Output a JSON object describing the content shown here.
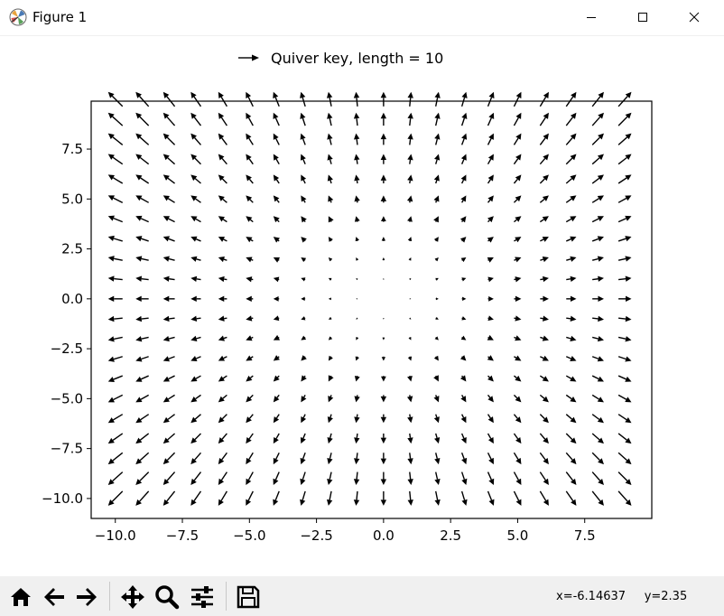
{
  "window": {
    "title": "Figure 1",
    "icon": "matplotlib-icon",
    "controls": [
      "minimize-icon",
      "maximize-icon",
      "close-icon"
    ]
  },
  "chart_data": {
    "type": "quiver",
    "title": "",
    "xlabel": "",
    "ylabel": "",
    "xlim": [
      -10.9,
      10.0
    ],
    "ylim": [
      -11.0,
      9.9
    ],
    "x_start": -10.0,
    "y_start": -10.0,
    "step": 1.0,
    "nx": 20,
    "ny": 21,
    "field": "radial: u = x, v = y (vectors point outward from origin, length proportional to distance)",
    "xticks": [
      -10.0,
      -7.5,
      -5.0,
      -2.5,
      0.0,
      2.5,
      5.0,
      7.5
    ],
    "xtick_labels": [
      "−10.0",
      "−7.5",
      "−5.0",
      "−2.5",
      "0.0",
      "2.5",
      "5.0",
      "7.5"
    ],
    "yticks": [
      -10.0,
      -7.5,
      -5.0,
      -2.5,
      0.0,
      2.5,
      5.0,
      7.5
    ],
    "ytick_labels": [
      "−10.0",
      "−7.5",
      "−5.0",
      "−2.5",
      "0.0",
      "2.5",
      "5.0",
      "7.5"
    ],
    "grid": false,
    "quiver_key": {
      "label": "Quiver key, length = 10",
      "length": 10,
      "placement": "above plot"
    },
    "color": "#000000"
  },
  "toolbar": {
    "buttons": [
      {
        "name": "home-button",
        "icon": "home-icon"
      },
      {
        "name": "back-button",
        "icon": "arrow-left-icon"
      },
      {
        "name": "forward-button",
        "icon": "arrow-right-icon"
      },
      {
        "name": "pan-button",
        "icon": "move-icon"
      },
      {
        "name": "zoom-button",
        "icon": "magnifier-icon"
      },
      {
        "name": "configure-subplots-button",
        "icon": "sliders-icon"
      },
      {
        "name": "save-button",
        "icon": "floppy-disk-icon"
      }
    ],
    "coords": "x=-6.14637     y=2.35"
  }
}
